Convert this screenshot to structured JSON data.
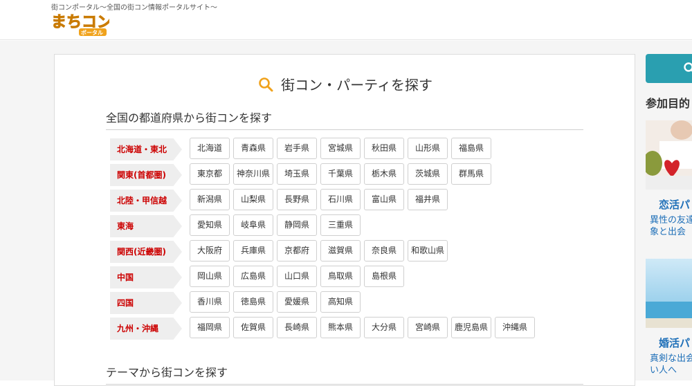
{
  "header": {
    "tagline": "街コンポータル〜全国の街コン情報ポータルサイト〜",
    "logo_text": "まちコン",
    "logo_sub": "ポータル",
    "logo_color": "#f0a21c"
  },
  "main": {
    "title": "街コン・パーティを探す",
    "section_prefecture": "全国の都道府県から街コンを探す",
    "section_theme": "テーマから街コンを探す",
    "regions": [
      {
        "label": "北海道・東北",
        "prefs": [
          "北海道",
          "青森県",
          "岩手県",
          "宮城県",
          "秋田県",
          "山形県",
          "福島県"
        ]
      },
      {
        "label": "関東(首都圏)",
        "prefs": [
          "東京都",
          "神奈川県",
          "埼玉県",
          "千葉県",
          "栃木県",
          "茨城県",
          "群馬県"
        ]
      },
      {
        "label": "北陸・甲信越",
        "prefs": [
          "新潟県",
          "山梨県",
          "長野県",
          "石川県",
          "富山県",
          "福井県"
        ]
      },
      {
        "label": "東海",
        "prefs": [
          "愛知県",
          "岐阜県",
          "静岡県",
          "三重県"
        ]
      },
      {
        "label": "関西(近畿圏)",
        "prefs": [
          "大阪府",
          "兵庫県",
          "京都府",
          "滋賀県",
          "奈良県",
          "和歌山県"
        ]
      },
      {
        "label": "中国",
        "prefs": [
          "岡山県",
          "広島県",
          "山口県",
          "鳥取県",
          "島根県"
        ]
      },
      {
        "label": "四国",
        "prefs": [
          "香川県",
          "徳島県",
          "愛媛県",
          "高知県"
        ]
      },
      {
        "label": "九州・沖縄",
        "prefs": [
          "福岡県",
          "佐賀県",
          "長崎県",
          "熊本県",
          "大分県",
          "宮崎県",
          "鹿児島県",
          "沖縄県"
        ]
      }
    ]
  },
  "sidebar": {
    "heading": "参加目的",
    "card1_title": "恋活パ",
    "card1_desc_1": "異性の友達",
    "card1_desc_2": "象と出会",
    "card2_title": "婚活パ",
    "card2_desc_1": "真剣な出会",
    "card2_desc_2": "い人へ"
  },
  "colors": {
    "region_label": "#cc0000",
    "accent": "#2a9fb0",
    "link": "#1e6fb8",
    "search_icon": "#f0a21c"
  }
}
